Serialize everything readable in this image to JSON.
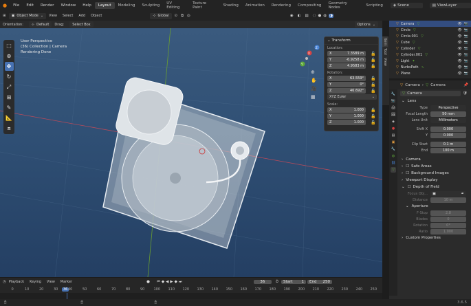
{
  "menubar": {
    "items": [
      "File",
      "Edit",
      "Render",
      "Window",
      "Help"
    ],
    "workspaces": [
      "Layout",
      "Modeling",
      "Sculpting",
      "UV Editing",
      "Texture Paint",
      "Shading",
      "Animation",
      "Rendering",
      "Compositing",
      "Geometry Nodes",
      "Scripting"
    ],
    "active_workspace": "Layout",
    "scene": "Scene",
    "view_layer": "ViewLayer"
  },
  "header": {
    "mode": "Object Mode",
    "menus": [
      "View",
      "Select",
      "Add",
      "Object"
    ],
    "orientation_label": "Orientation:",
    "orientation": "Default",
    "drag_label": "Drag:",
    "drag": "Select Box",
    "transform_orientation": "Global",
    "options": "Options"
  },
  "overlay": {
    "line1": "User Perspective",
    "line2": "(36) Collection | Camera",
    "line3": "Rendering Done"
  },
  "transform": {
    "title": "Transform",
    "location_label": "Location:",
    "loc": [
      "7.3589 m",
      "-6.9258 m",
      "4.9583 m"
    ],
    "rotation_label": "Rotation:",
    "rot": [
      "63.559°",
      "0°",
      "46.692°"
    ],
    "rotation_mode": "XYZ Euler",
    "scale_label": "Scale:",
    "scale": [
      "1.000",
      "1.000",
      "1.000"
    ],
    "axes": [
      "X",
      "Y",
      "Z"
    ]
  },
  "sidetabs": [
    "Item",
    "Tool",
    "View"
  ],
  "outliner": [
    {
      "name": "Camera",
      "sel": true
    },
    {
      "name": "Circle"
    },
    {
      "name": "Circle.001"
    },
    {
      "name": "Cube"
    },
    {
      "name": "Cylinder"
    },
    {
      "name": "Cylinder.001"
    },
    {
      "name": "Light"
    },
    {
      "name": "NurbsPath"
    },
    {
      "name": "Plane"
    }
  ],
  "props": {
    "breadcrumb1": "Camera",
    "breadcrumb2": "Camera",
    "data_name": "Camera",
    "lens_header": "Lens",
    "type_label": "Type",
    "type": "Perspective",
    "focal_label": "Focal Length",
    "focal": "50 mm",
    "unit_label": "Lens Unit",
    "unit": "Millimeters",
    "shiftx_label": "Shift X",
    "shiftx": "0.000",
    "y_label": "Y",
    "shifty": "0.000",
    "clipstart_label": "Clip Start",
    "clipstart": "0.1 m",
    "end_label": "End",
    "clipend": "100 m",
    "camera_header": "Camera",
    "safe_areas": "Safe Areas",
    "background": "Background Images",
    "viewport_display": "Viewport Display",
    "dof": "Depth of Field",
    "focus_obj_label": "Focus Obj...",
    "distance_label": "Distance",
    "distance": "10 m",
    "aperture": "Aperture",
    "fstop_label": "F-Stop",
    "fstop": "2.8",
    "blades_label": "Blades",
    "blades": "0",
    "rotation_label": "Rotation",
    "rotation": "0°",
    "ratio_label": "Ratio",
    "ratio": "1.000",
    "custom_props": "Custom Properties"
  },
  "timeline": {
    "menus": [
      "Playback",
      "Keying",
      "View",
      "Marker"
    ],
    "current": "36",
    "start_label": "Start",
    "start": "1",
    "end_label": "End",
    "end": "250",
    "ticks": [
      "0",
      "10",
      "20",
      "30",
      "36",
      "40",
      "50",
      "60",
      "70",
      "80",
      "90",
      "100",
      "110",
      "120",
      "130",
      "140",
      "150",
      "160",
      "170",
      "180",
      "190",
      "200",
      "210",
      "220",
      "230",
      "240",
      "250"
    ]
  },
  "version": "3.6.5"
}
